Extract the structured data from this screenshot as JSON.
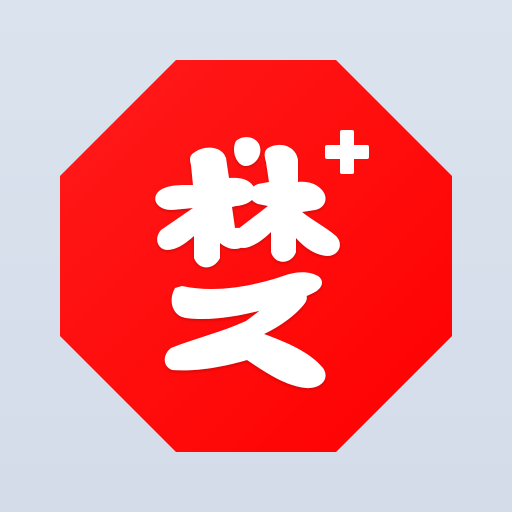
{
  "icon": {
    "name": "octagon-calligraphy-plus-icon",
    "glyph": "梦",
    "badge": "+"
  },
  "colors": {
    "background": "#d8e0ea",
    "octagon": "#ff0000",
    "octagon_dark": "#e00000",
    "glyph": "#ffffff"
  }
}
